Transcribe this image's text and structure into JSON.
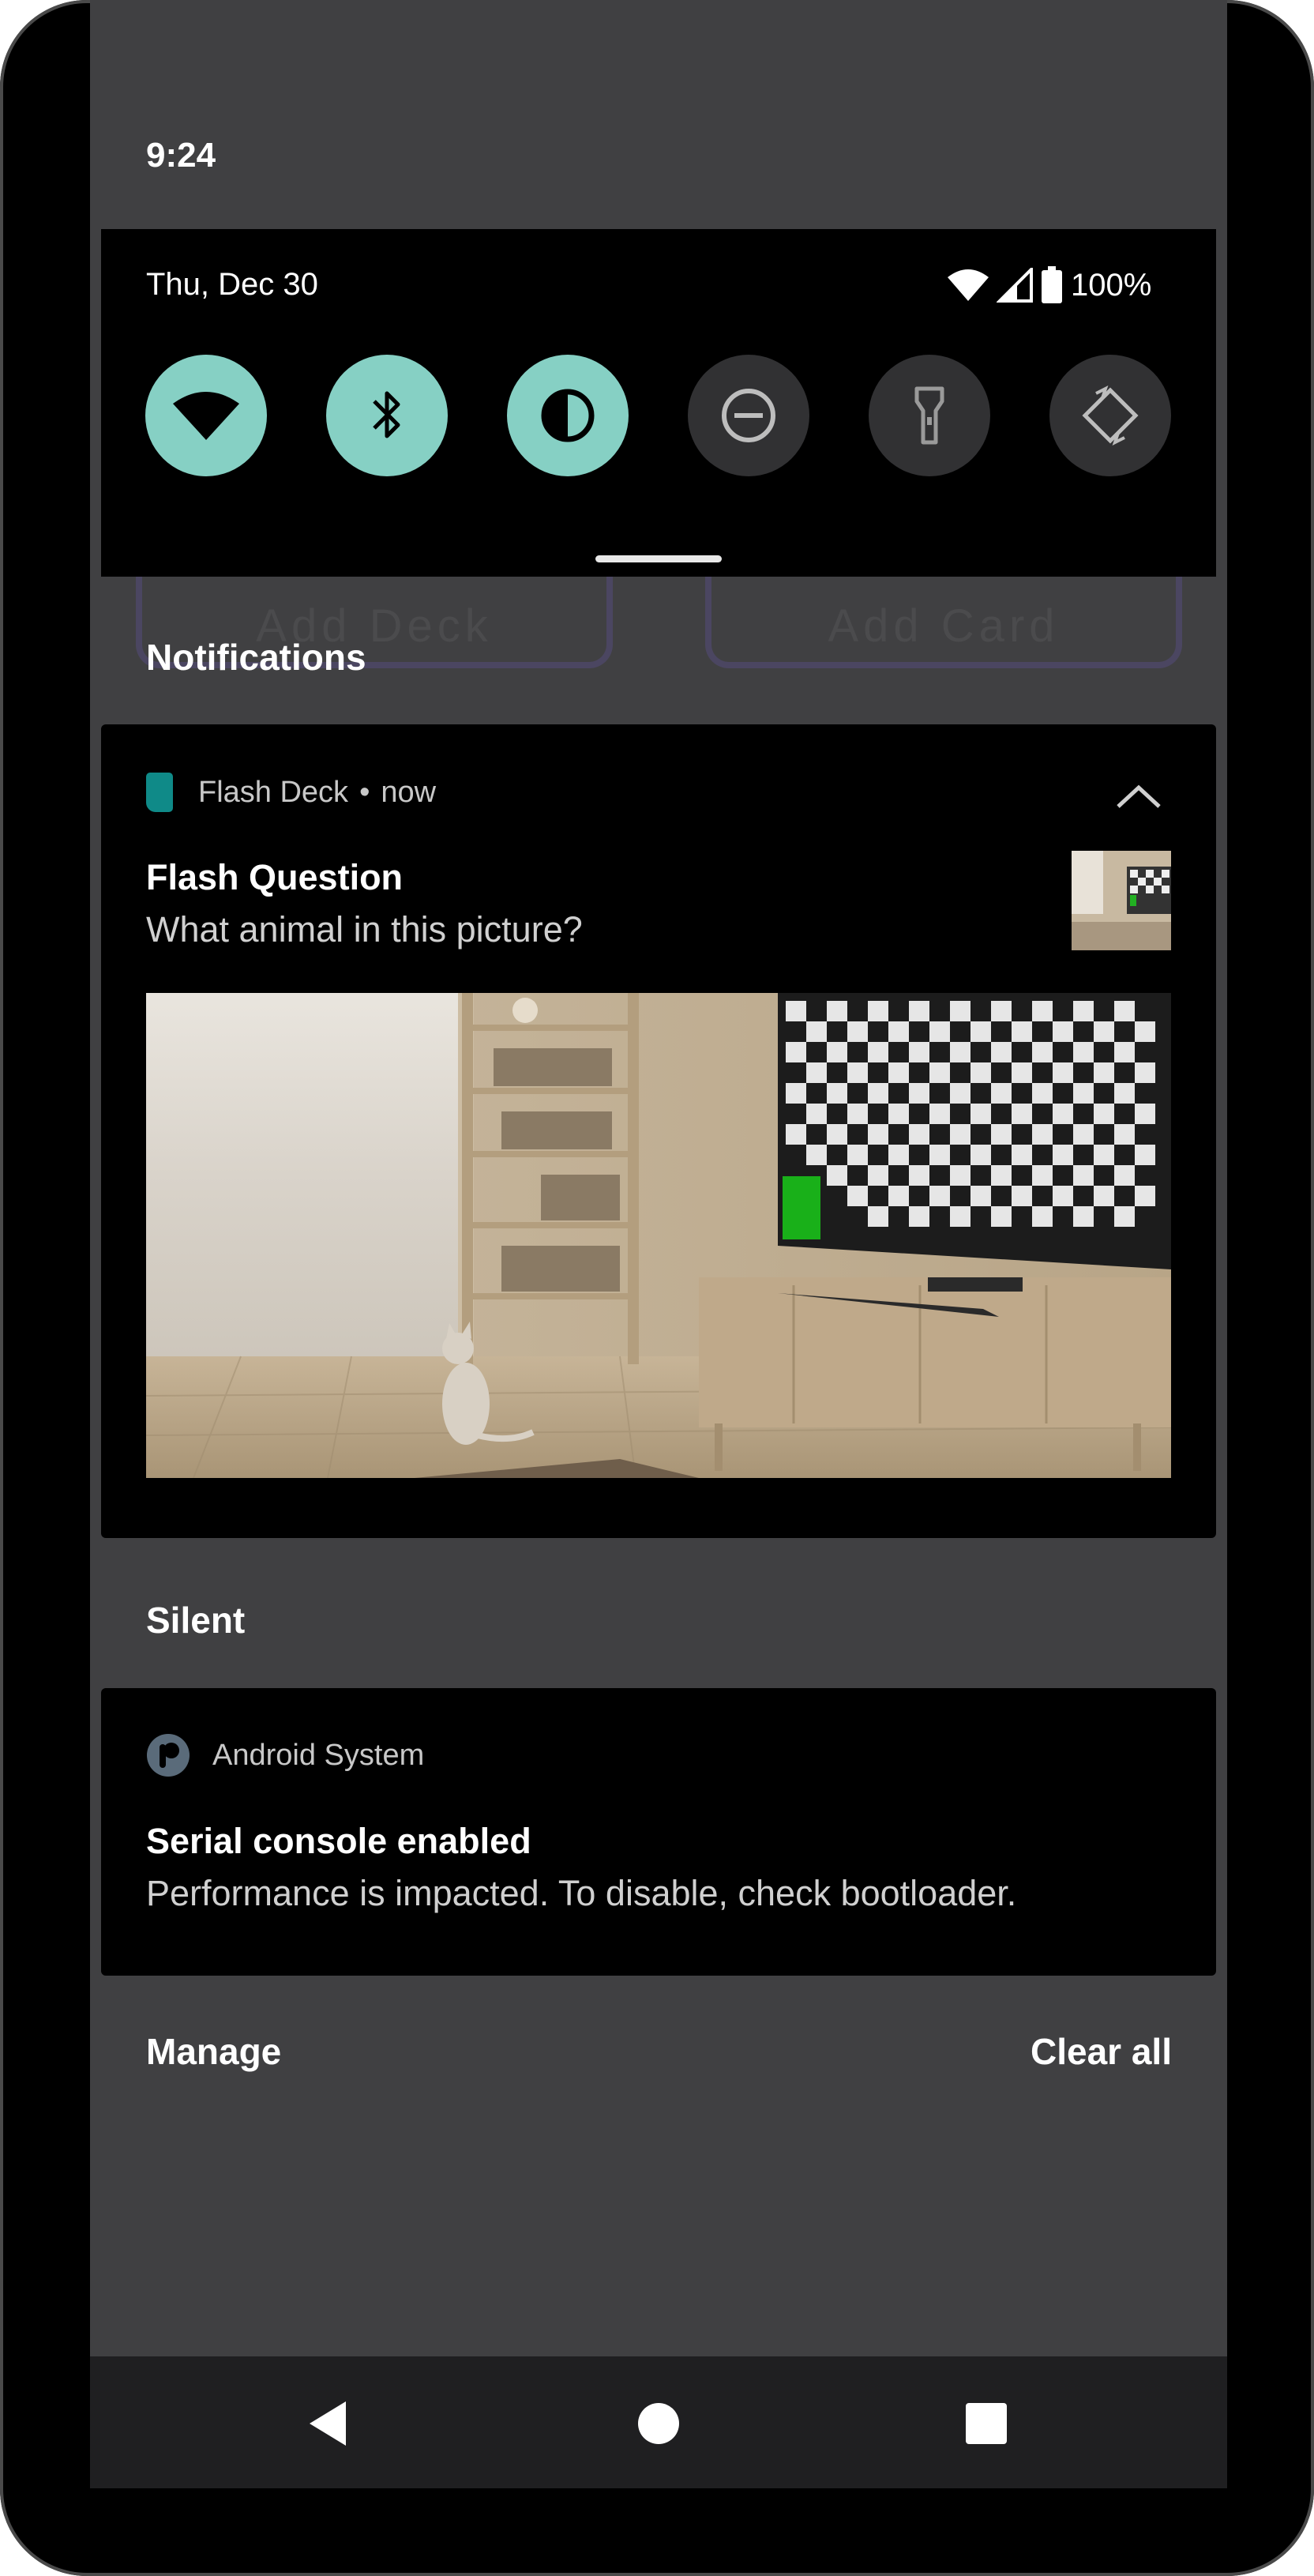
{
  "status_bar": {
    "time": "9:24"
  },
  "quick_settings": {
    "date": "Thu, Dec 30",
    "battery": "100%",
    "tiles": [
      {
        "name": "wifi-icon",
        "state": "on"
      },
      {
        "name": "bluetooth-icon",
        "state": "on"
      },
      {
        "name": "dark-theme-icon",
        "state": "on"
      },
      {
        "name": "do-not-disturb-icon",
        "state": "off"
      },
      {
        "name": "flashlight-icon",
        "state": "off"
      },
      {
        "name": "auto-rotate-icon",
        "state": "off"
      }
    ]
  },
  "background_app": {
    "add_deck": "Add Deck",
    "add_card": "Add Card"
  },
  "sections": {
    "notifications": "Notifications",
    "silent": "Silent"
  },
  "notification_1": {
    "app_name": "Flash Deck",
    "separator": "•",
    "time": "now",
    "title": "Flash Question",
    "text": "What animal in this picture?"
  },
  "notification_2": {
    "app_name": "Android System",
    "title": "Serial console enabled",
    "text": "Performance is impacted. To disable, check bootloader."
  },
  "footer": {
    "manage": "Manage",
    "clear_all": "Clear all"
  },
  "colors": {
    "tile_on": "#86d0c4",
    "tile_off": "#313133",
    "shade_bg": "#404042",
    "card_bg": "#000000",
    "app_icon": "#0f8a88"
  }
}
